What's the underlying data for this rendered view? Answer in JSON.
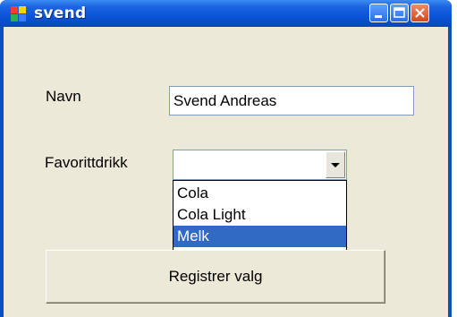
{
  "window": {
    "title": "svend"
  },
  "form": {
    "name_label": "Navn",
    "name_value": "Svend Andreas",
    "drink_label": "Favorittdrikk",
    "drink_value": "",
    "options": [
      "Cola",
      "Cola Light",
      "Melk"
    ],
    "selected_option": "Melk",
    "submit_label": "Registrer valg"
  },
  "icons": {
    "app": "app-window-icon",
    "minimize": "minimize-icon",
    "maximize": "maximize-icon",
    "close": "close-icon",
    "dropdown": "chevron-down-icon"
  },
  "colors": {
    "titlebar": "#0a55d8",
    "client_background": "#ece9d8",
    "selection": "#316ac5",
    "close_button": "#d4471f"
  }
}
